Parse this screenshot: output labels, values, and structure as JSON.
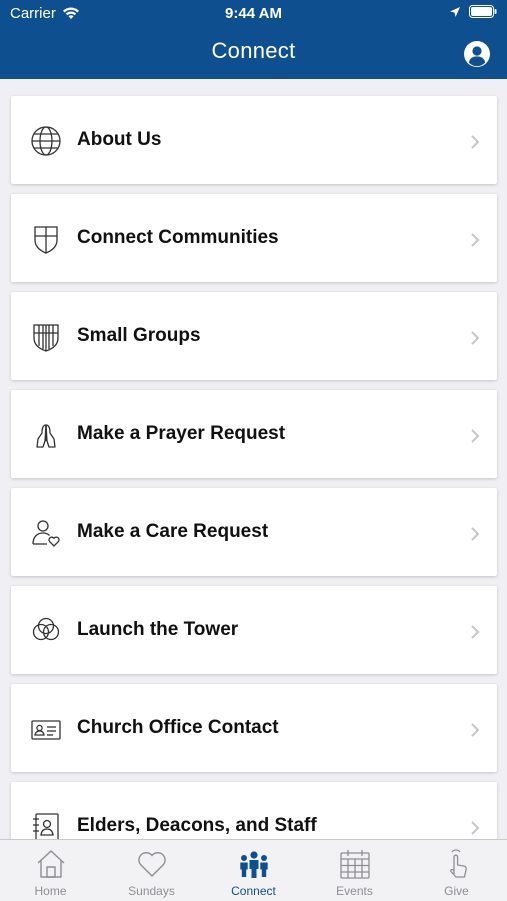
{
  "status_bar": {
    "carrier": "Carrier",
    "time": "9:44 AM"
  },
  "nav": {
    "title": "Connect"
  },
  "items": [
    {
      "label": "About Us",
      "icon": "globe-icon"
    },
    {
      "label": "Connect Communities",
      "icon": "shield-icon"
    },
    {
      "label": "Small Groups",
      "icon": "striped-shield-icon"
    },
    {
      "label": "Make a Prayer Request",
      "icon": "praying-hands-icon"
    },
    {
      "label": "Make a Care Request",
      "icon": "person-heart-icon"
    },
    {
      "label": "Launch the Tower",
      "icon": "interlocking-rings-icon"
    },
    {
      "label": "Church Office Contact",
      "icon": "contact-card-icon"
    },
    {
      "label": "Elders, Deacons, and Staff",
      "icon": "address-book-icon"
    }
  ],
  "tabs": [
    {
      "label": "Home",
      "icon": "home-icon"
    },
    {
      "label": "Sundays",
      "icon": "heart-icon"
    },
    {
      "label": "Connect",
      "icon": "people-icon",
      "active": true
    },
    {
      "label": "Events",
      "icon": "calendar-icon"
    },
    {
      "label": "Give",
      "icon": "tap-hand-icon"
    }
  ],
  "colors": {
    "header": "#0d4f8f",
    "active_tab": "#0d4f8f",
    "inactive_tab": "#8e8e93"
  }
}
